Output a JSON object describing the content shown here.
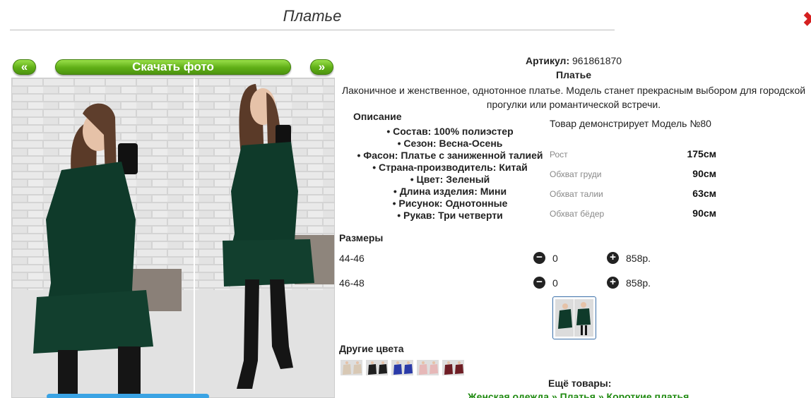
{
  "header": {
    "title": "Платье",
    "close_icon": "close-icon"
  },
  "gallery": {
    "prev_label": "«",
    "next_label": "»",
    "download_label": "Скачать фото"
  },
  "product": {
    "article_label": "Артикул:",
    "article_value": "961861870",
    "name": "Платье",
    "description_line1": "Лаконичное и женственное, однотонное платье. Модель станет прекрасным выбором для городской",
    "description_line2": "прогулки или романтической встречи."
  },
  "specs": {
    "title": "Описание",
    "items": [
      "Состав: 100% полиэстер",
      "Сезон: Весна-Осень",
      "Фасон: Платье с заниженной талией",
      "Страна-производитель: Китай",
      "Цвет: Зеленый",
      "Длина изделия: Мини",
      "Рисунок: Однотонные",
      "Рукав: Три четверти"
    ]
  },
  "model": {
    "title": "Товар демонстрирует Модель №80",
    "measurements": [
      {
        "label": "Рост",
        "value": "175см"
      },
      {
        "label": "Обхват груди",
        "value": "90см"
      },
      {
        "label": "Обхват талии",
        "value": "63см"
      },
      {
        "label": "Обхват бёдер",
        "value": "90см"
      }
    ]
  },
  "sizes": {
    "title": "Размеры",
    "rows": [
      {
        "size": "44-46",
        "qty": "0",
        "price": "858р."
      },
      {
        "size": "46-48",
        "qty": "0",
        "price": "858р."
      }
    ]
  },
  "other_colors": {
    "title": "Другие цвета",
    "swatches": [
      "#d8c8b4",
      "#1e1e1e",
      "#2a3aa8",
      "#e6b8b8",
      "#6e1d24"
    ]
  },
  "more": {
    "title": "Ещё товары:",
    "crumbs": [
      "Женская одежда",
      "Платья",
      "Короткие платья"
    ],
    "separator": "»"
  },
  "colors": {
    "accent_green": "#5fae16",
    "link_green": "#1f8a10",
    "dress_green": "#0f3a2a"
  }
}
